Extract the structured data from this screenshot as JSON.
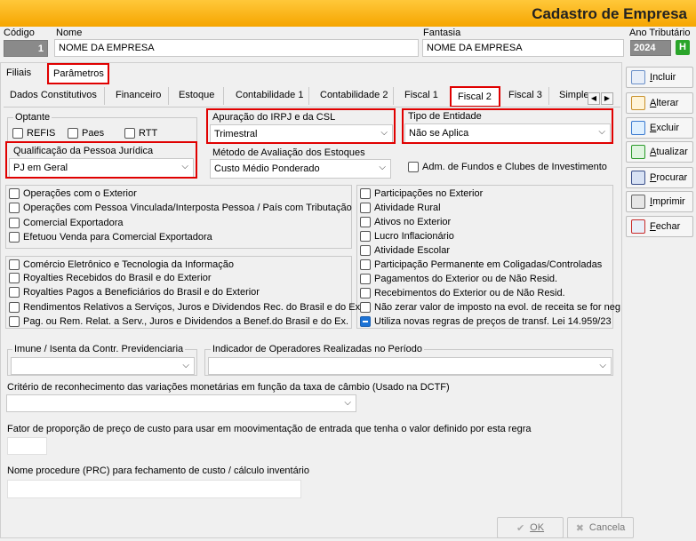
{
  "window": {
    "title": "Cadastro de Empresa"
  },
  "header": {
    "codigo_label": "Código",
    "codigo_value": "1",
    "nome_label": "Nome",
    "nome_value": "NOME DA EMPRESA",
    "fantasia_label": "Fantasia",
    "fantasia_value": "NOME DA EMPRESA",
    "ano_label": "Ano Tributário",
    "ano_value": "2024",
    "ano_btn": "H"
  },
  "top_tabs": [
    "Filiais",
    "Parâmetros"
  ],
  "sub_tabs": [
    "Dados Constitutivos",
    "Financeiro",
    "Estoque",
    "Contabilidade 1",
    "Contabilidade 2",
    "Fiscal 1",
    "Fiscal 2",
    "Fiscal 3",
    "Simple"
  ],
  "optante": {
    "label": "Optante",
    "items": [
      "REFIS",
      "Paes",
      "RTT"
    ]
  },
  "apuracao": {
    "label": "Apuração do IRPJ e da CSL",
    "value": "Trimestral"
  },
  "tipo_entidade": {
    "label": "Tipo de Entidade",
    "value": "Não se Aplica"
  },
  "qualificacao": {
    "label": "Qualificação da Pessoa Jurídica",
    "value": "PJ em Geral"
  },
  "metodo": {
    "label": "Método de Avaliação dos Estoques",
    "value": "Custo Médio Ponderado"
  },
  "adm_fundos": "Adm. de Fundos e Clubes de Investimento",
  "left_checks_1": [
    "Operações com o Exterior",
    "Operações com Pessoa Vinculada/Interposta Pessoa / País com Tributação",
    "Comercial Exportadora",
    "Efetuou Venda para Comercial Exportadora"
  ],
  "left_checks_2": [
    "Comércio Eletrônico e Tecnologia da Informação",
    "Royalties Recebidos do Brasil e do Exterior",
    "Royalties Pagos a Beneficiários do Brasil e do Exterior",
    "Rendimentos Relativos a Serviços, Juros e Dividendos Rec. do Brasil e do Ex.",
    "Pag. ou Rem.  Relat. a Serv., Juros e Dividendos a Benef.do Brasil e do Ex."
  ],
  "right_checks": [
    "Participações no Exterior",
    "Atividade Rural",
    "Ativos no Exterior",
    "Lucro Inflacionário",
    "Atividade Escolar",
    "Participação Permanente em Coligadas/Controladas",
    "Pagamentos do Exterior ou de Não Resid.",
    "Recebimentos do Exterior ou de Não Resid.",
    "Não zerar valor de imposto na evol. de receita se for neg",
    "Utiliza novas regras de preços de transf.  Lei 14.959/23"
  ],
  "imune_label": "Imune / Isenta da Contr. Previdenciaria",
  "indicador_label": "Indicador de Operadores Realizadas no Período",
  "criterio_label": "Critério de reconhecimento das variações monetárias em função da taxa de câmbio  (Usado na DCTF)",
  "fator_label": "Fator de proporção de preço de custo para usar em moovimentação de entrada que tenha o valor definido por esta regra",
  "nome_proc_label": "Nome procedure (PRC) para fechamento de custo / cálculo inventário",
  "side_buttons": [
    {
      "u": "I",
      "rest": "ncluir",
      "icon": "add-doc-icon"
    },
    {
      "u": "A",
      "rest": "lterar",
      "icon": "edit-icon"
    },
    {
      "u": "E",
      "rest": "xcluir",
      "icon": "delete-icon"
    },
    {
      "u": "A",
      "rest": "tualizar",
      "icon": "refresh-icon"
    },
    {
      "u": "P",
      "rest": "rocurar",
      "icon": "binoculars-icon"
    },
    {
      "u": "I",
      "rest": "mprimir",
      "icon": "printer-icon"
    },
    {
      "u": "F",
      "rest": "echar",
      "icon": "close-window-icon"
    }
  ],
  "bottom": {
    "ok": "OK",
    "cancel": "Cancela"
  },
  "colors": {
    "title_bar": "#f6a500",
    "highlight": "#e00000",
    "check_on": "#1c73d6",
    "green_btn": "#2aa52a"
  }
}
